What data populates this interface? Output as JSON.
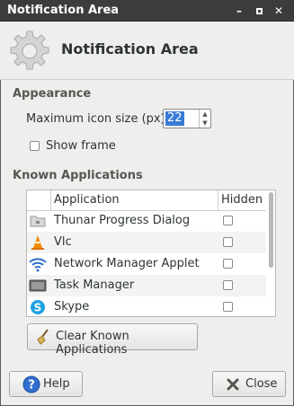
{
  "window": {
    "title": "Notification Area"
  },
  "header": {
    "title": "Notification Area",
    "icon": "gear-icon"
  },
  "appearance": {
    "section_title": "Appearance",
    "max_icon_size_label": "Maximum icon size (px):",
    "max_icon_size_value": "22",
    "show_frame_label": "Show frame",
    "show_frame_checked": false
  },
  "known_apps": {
    "section_title": "Known Applications",
    "columns": [
      "Application",
      "Hidden"
    ],
    "rows": [
      {
        "name": "Thunar Progress Dialog",
        "icon": "folder-icon",
        "hidden": false
      },
      {
        "name": "Vlc",
        "icon": "vlc-cone-icon",
        "hidden": false
      },
      {
        "name": "Network Manager Applet",
        "icon": "wifi-icon",
        "hidden": false
      },
      {
        "name": "Task Manager",
        "icon": "task-manager-icon",
        "hidden": false
      },
      {
        "name": "Skype",
        "icon": "skype-icon",
        "hidden": false
      }
    ],
    "clear_button_label": "Clear Known Applications"
  },
  "footer": {
    "help_label": "Help",
    "close_label": "Close"
  },
  "colors": {
    "titlebar": "#3c3c3c",
    "selection": "#3a7bd5",
    "accent_help": "#2f6fd0",
    "close_x": "#555753"
  }
}
